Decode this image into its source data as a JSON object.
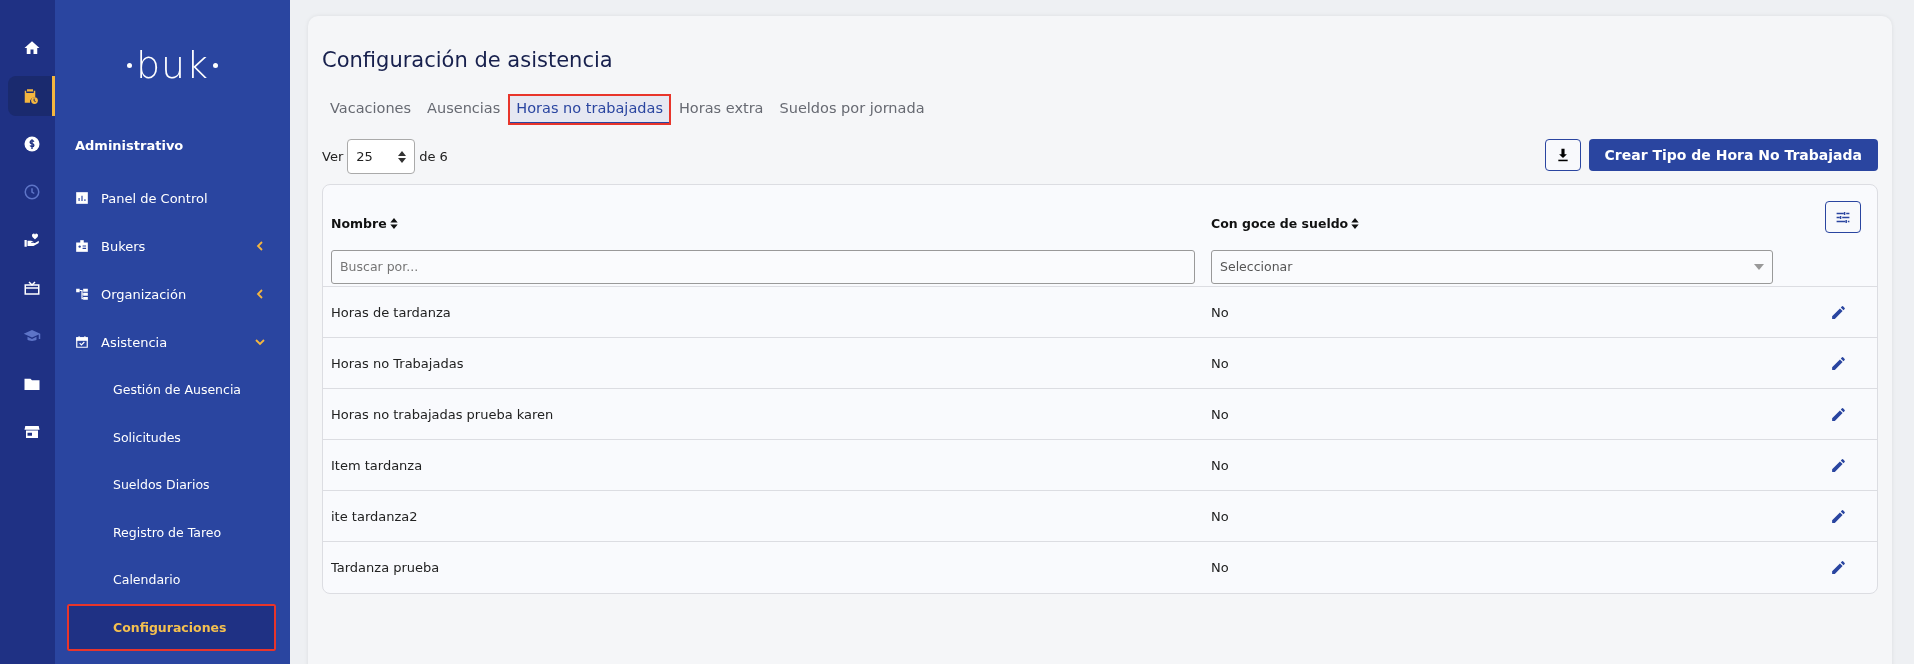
{
  "rail": [
    {
      "selected": false,
      "disabled": false
    },
    {
      "selected": true,
      "disabled": false
    },
    {
      "selected": false,
      "disabled": false
    },
    {
      "selected": false,
      "disabled": true
    },
    {
      "selected": false,
      "disabled": false
    },
    {
      "selected": false,
      "disabled": false
    },
    {
      "selected": false,
      "disabled": true
    },
    {
      "selected": false,
      "disabled": false
    },
    {
      "selected": false,
      "disabled": false
    }
  ],
  "sidebar": {
    "logo": "buk",
    "section": "Administrativo",
    "items": [
      {
        "label": "Panel de Control",
        "kind": "link"
      },
      {
        "label": "Bukers",
        "kind": "group",
        "expanded": false
      },
      {
        "label": "Organización",
        "kind": "group",
        "expanded": false
      },
      {
        "label": "Asistencia",
        "kind": "group",
        "expanded": true,
        "children": [
          {
            "label": "Gestión de Ausencia",
            "selected": false,
            "highlighted": false
          },
          {
            "label": "Solicitudes",
            "selected": false,
            "highlighted": false
          },
          {
            "label": "Sueldos Diarios",
            "selected": false,
            "highlighted": false
          },
          {
            "label": "Registro de Tareo",
            "selected": false,
            "highlighted": false
          },
          {
            "label": "Calendario",
            "selected": false,
            "highlighted": false
          },
          {
            "label": "Configuraciones",
            "selected": true,
            "highlighted": true
          }
        ]
      }
    ]
  },
  "page": {
    "title": "Configuración de asistencia",
    "tabs": [
      {
        "label": "Vacaciones",
        "selected": false,
        "highlighted": false
      },
      {
        "label": "Ausencias",
        "selected": false,
        "highlighted": false
      },
      {
        "label": "Horas no trabajadas",
        "selected": true,
        "highlighted": true
      },
      {
        "label": "Horas extra",
        "selected": false,
        "highlighted": false
      },
      {
        "label": "Sueldos por jornada",
        "selected": false,
        "highlighted": false
      }
    ],
    "pager": {
      "prefix": "Ver",
      "value": "25",
      "suffix": "de 6"
    },
    "create_button": "Crear Tipo de Hora No Trabajada"
  },
  "table": {
    "columns": [
      {
        "label": "Nombre",
        "placeholder": "Buscar por...",
        "kind": "text"
      },
      {
        "label": "Con goce de sueldo",
        "placeholder": "Seleccionar",
        "kind": "select"
      }
    ],
    "rows": [
      [
        "Horas de tardanza",
        "No"
      ],
      [
        "Horas no Trabajadas",
        "No"
      ],
      [
        "Horas no trabajadas prueba karen",
        "No"
      ],
      [
        "Item tardanza",
        "No"
      ],
      [
        "ite tardanza2",
        "No"
      ],
      [
        "Tardanza prueba",
        "No"
      ]
    ]
  }
}
